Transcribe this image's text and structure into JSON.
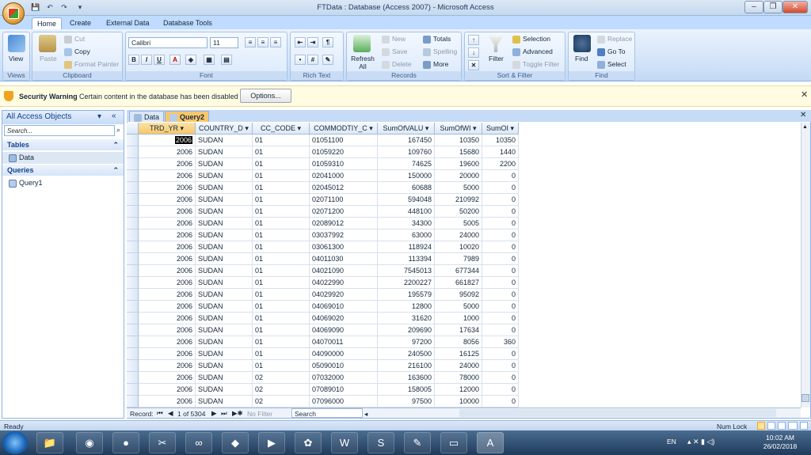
{
  "window": {
    "title": "FTData : Database (Access 2007) - Microsoft Access"
  },
  "ribbon_tabs": [
    "Home",
    "Create",
    "External Data",
    "Database Tools"
  ],
  "ribbon": {
    "views": {
      "view_label": "View",
      "group": "Views"
    },
    "clipboard": {
      "paste": "Paste",
      "cut": "Cut",
      "copy": "Copy",
      "format_painter": "Format Painter",
      "group": "Clipboard"
    },
    "font": {
      "font_name": "Calibri",
      "font_size": "11",
      "bold": "B",
      "italic": "I",
      "underline": "U",
      "group": "Font"
    },
    "rich_text": {
      "group": "Rich Text"
    },
    "records": {
      "refresh": "Refresh All",
      "new": "New",
      "save": "Save",
      "delete": "Delete",
      "totals": "Totals",
      "spelling": "Spelling",
      "more": "More",
      "group": "Records"
    },
    "sort_filter": {
      "filter": "Filter",
      "selection": "Selection",
      "advanced": "Advanced",
      "toggle_filter": "Toggle Filter",
      "group": "Sort & Filter"
    },
    "find": {
      "find": "Find",
      "replace": "Replace",
      "goto": "Go To",
      "select": "Select",
      "group": "Find"
    }
  },
  "security": {
    "title": "Security Warning",
    "message": "Certain content in the database has been disabled",
    "options_label": "Options..."
  },
  "nav_pane": {
    "title": "All Access Objects",
    "search_placeholder": "Search...",
    "groups": [
      {
        "name": "Tables",
        "items": [
          "Data"
        ]
      },
      {
        "name": "Queries",
        "items": [
          "Query1"
        ]
      }
    ]
  },
  "doc_tabs": [
    "Data",
    "Query2"
  ],
  "grid": {
    "columns": [
      "TRD_YR",
      "COUNTRY_D",
      "CC_CODE",
      "COMMODTIY_C",
      "SumOfVALU",
      "SumOfWI",
      "SumOI"
    ],
    "rows": [
      [
        "2006",
        "SUDAN",
        "01",
        "01051100",
        "167450",
        "10350",
        "10350"
      ],
      [
        "2006",
        "SUDAN",
        "01",
        "01059220",
        "109760",
        "15680",
        "1440"
      ],
      [
        "2006",
        "SUDAN",
        "01",
        "01059310",
        "74625",
        "19600",
        "2200"
      ],
      [
        "2006",
        "SUDAN",
        "01",
        "02041000",
        "150000",
        "20000",
        "0"
      ],
      [
        "2006",
        "SUDAN",
        "01",
        "02045012",
        "60688",
        "5000",
        "0"
      ],
      [
        "2006",
        "SUDAN",
        "01",
        "02071100",
        "594048",
        "210992",
        "0"
      ],
      [
        "2006",
        "SUDAN",
        "01",
        "02071200",
        "448100",
        "50200",
        "0"
      ],
      [
        "2006",
        "SUDAN",
        "01",
        "02089012",
        "34300",
        "5005",
        "0"
      ],
      [
        "2006",
        "SUDAN",
        "01",
        "03037992",
        "63000",
        "24000",
        "0"
      ],
      [
        "2006",
        "SUDAN",
        "01",
        "03061300",
        "118924",
        "10020",
        "0"
      ],
      [
        "2006",
        "SUDAN",
        "01",
        "04011030",
        "113394",
        "7989",
        "0"
      ],
      [
        "2006",
        "SUDAN",
        "01",
        "04021090",
        "7545013",
        "677344",
        "0"
      ],
      [
        "2006",
        "SUDAN",
        "01",
        "04022990",
        "2200227",
        "661827",
        "0"
      ],
      [
        "2006",
        "SUDAN",
        "01",
        "04029920",
        "195579",
        "95092",
        "0"
      ],
      [
        "2006",
        "SUDAN",
        "01",
        "04069010",
        "12800",
        "5000",
        "0"
      ],
      [
        "2006",
        "SUDAN",
        "01",
        "04069020",
        "31620",
        "1000",
        "0"
      ],
      [
        "2006",
        "SUDAN",
        "01",
        "04069090",
        "209690",
        "17634",
        "0"
      ],
      [
        "2006",
        "SUDAN",
        "01",
        "04070011",
        "97200",
        "8056",
        "360"
      ],
      [
        "2006",
        "SUDAN",
        "01",
        "04090000",
        "240500",
        "16125",
        "0"
      ],
      [
        "2006",
        "SUDAN",
        "01",
        "05090010",
        "216100",
        "24000",
        "0"
      ],
      [
        "2006",
        "SUDAN",
        "02",
        "07032000",
        "163600",
        "78000",
        "0"
      ],
      [
        "2006",
        "SUDAN",
        "02",
        "07089010",
        "158005",
        "12000",
        "0"
      ],
      [
        "2006",
        "SUDAN",
        "02",
        "07096000",
        "97500",
        "10000",
        "0"
      ]
    ]
  },
  "record_nav": {
    "label": "Record:",
    "position": "1 of 5304",
    "filter": "No Filter",
    "search": "Search"
  },
  "status": {
    "left": "Ready",
    "right": "Num Lock"
  },
  "taskbar": {
    "lang": "EN",
    "time": "10:02 AM",
    "date": "26/02/2018"
  },
  "colors": {
    "accent": "#c4d8ee",
    "active_tab": "#f7c76a",
    "warning": "#fffce2"
  }
}
